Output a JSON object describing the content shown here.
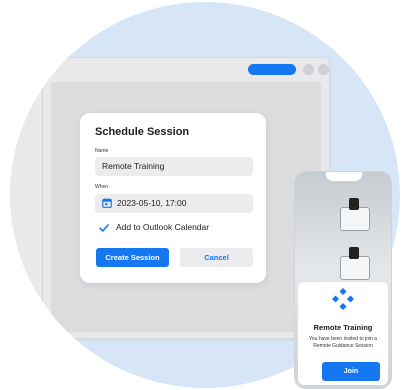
{
  "colors": {
    "accent": "#1677f2",
    "background_circle": "#d7e6f7"
  },
  "dialog": {
    "title": "Schedule Session",
    "name_label": "Name",
    "name_value": "Remote Training",
    "when_label": "When",
    "when_value": "2023-05-10, 17:00",
    "calendar_icon": "calendar-icon",
    "outlook_checkbox": {
      "label": "Add to Outlook Calendar",
      "checked": true
    },
    "create_label": "Create Session",
    "cancel_label": "Cancel"
  },
  "phone": {
    "logo_icon": "diamond-logo-icon",
    "title": "Remote Training",
    "subtitle": "You have been invited to join a Remote Guidance Session",
    "join_label": "Join"
  }
}
